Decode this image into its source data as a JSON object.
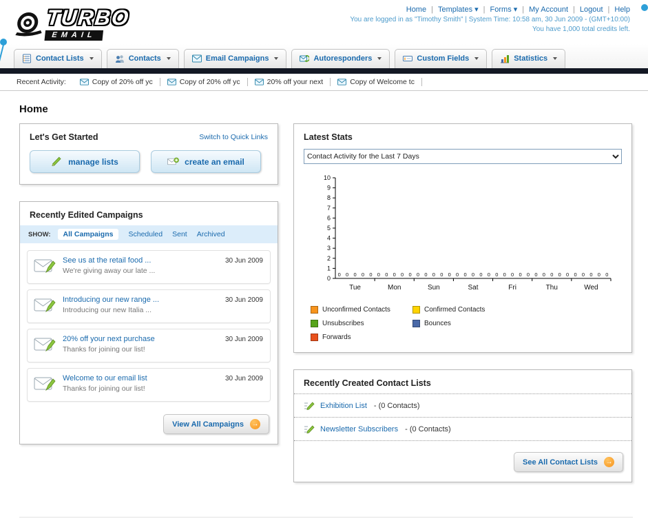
{
  "page": {
    "title": "Home"
  },
  "header": {
    "logo": {
      "line1": "TURBO",
      "line2": "EMAIL"
    },
    "links": [
      {
        "label": "Home"
      },
      {
        "label": "Templates ▾"
      },
      {
        "label": "Forms ▾"
      },
      {
        "label": "My Account"
      },
      {
        "label": "Logout"
      },
      {
        "label": "Help"
      }
    ],
    "login_line": "You are logged in as \"Timothy Smith\" | System Time: 10:58 am, 30 Jun 2009 - (GMT+10:00)",
    "credits_line": "You have 1,000 total credits left."
  },
  "main_nav": {
    "items": [
      {
        "label": "Contact Lists"
      },
      {
        "label": "Contacts"
      },
      {
        "label": "Email Campaigns"
      },
      {
        "label": "Autoresponders"
      },
      {
        "label": "Custom Fields"
      },
      {
        "label": "Statistics"
      }
    ]
  },
  "recent_activity": {
    "label": "Recent Activity:",
    "items": [
      "Copy of 20% off yc",
      "Copy of 20% off yc",
      "20% off your next",
      "Copy of Welcome tc"
    ]
  },
  "get_started": {
    "title": "Let's Get Started",
    "switch_link": "Switch to Quick Links",
    "manage_label": "manage lists",
    "create_label": "create an email"
  },
  "campaigns": {
    "title": "Recently Edited Campaigns",
    "show_label": "SHOW:",
    "tabs": [
      {
        "label": "All Campaigns",
        "active": true
      },
      {
        "label": "Scheduled",
        "active": false
      },
      {
        "label": "Sent",
        "active": false
      },
      {
        "label": "Archived",
        "active": false
      }
    ],
    "items": [
      {
        "title": "See us at the retail food ...",
        "subtitle": "We're giving away our late ...",
        "date": "30 Jun 2009"
      },
      {
        "title": "Introducing our new range ...",
        "subtitle": "Introducing our new Italia ...",
        "date": "30 Jun 2009"
      },
      {
        "title": "20% off your next purchase",
        "subtitle": "Thanks for joining our list!",
        "date": "30 Jun 2009"
      },
      {
        "title": "Welcome to our email list",
        "subtitle": "Thanks for joining our list!",
        "date": "30 Jun 2009"
      }
    ],
    "view_all_label": "View All Campaigns"
  },
  "latest_stats": {
    "title": "Latest Stats",
    "chart_data": {
      "type": "bar",
      "title": "Contact Activity for the Last 7 Days",
      "categories": [
        "Tue",
        "Mon",
        "Sun",
        "Sat",
        "Fri",
        "Thu",
        "Wed"
      ],
      "series": [
        {
          "name": "Unconfirmed Contacts",
          "color": "#f7941d",
          "values": [
            0,
            0,
            0,
            0,
            0,
            0,
            0
          ]
        },
        {
          "name": "Confirmed Contacts",
          "color": "#ffd400",
          "values": [
            0,
            0,
            0,
            0,
            0,
            0,
            0
          ]
        },
        {
          "name": "Unsubscribes",
          "color": "#57a41b",
          "values": [
            0,
            0,
            0,
            0,
            0,
            0,
            0
          ]
        },
        {
          "name": "Bounces",
          "color": "#4a69a8",
          "values": [
            0,
            0,
            0,
            0,
            0,
            0,
            0
          ]
        },
        {
          "name": "Forwards",
          "color": "#e8511d",
          "values": [
            0,
            0,
            0,
            0,
            0,
            0,
            0
          ]
        }
      ],
      "ylim": [
        0,
        10
      ],
      "ytick_step": 1,
      "grid": false,
      "legend_position": "bottom"
    }
  },
  "contact_lists": {
    "title": "Recently Created Contact Lists",
    "items": [
      {
        "name": "Exhibition List",
        "suffix": "- (0 Contacts)"
      },
      {
        "name": "Newsletter Subscribers",
        "suffix": "- (0 Contacts)"
      }
    ],
    "see_all_label": "See All Contact Lists"
  }
}
